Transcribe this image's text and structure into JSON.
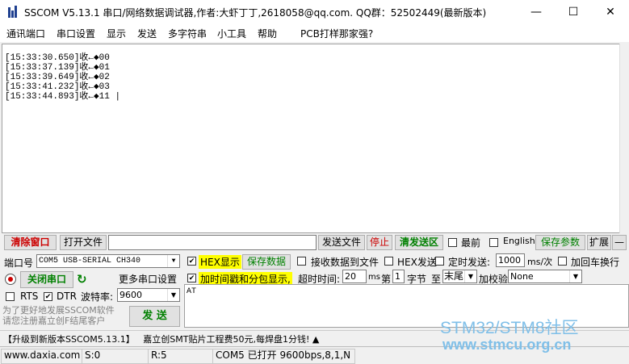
{
  "window": {
    "title": "SSCOM V5.13.1 串口/网络数据调试器,作者:大虾丁丁,2618058@qq.com. QQ群：52502449(最新版本)",
    "minimize": "—",
    "maximize": "☐",
    "close": "✕"
  },
  "menu": [
    "通讯端口",
    "串口设置",
    "显示",
    "发送",
    "多字符串",
    "小工具",
    "帮助",
    "PCB打样那家强?"
  ],
  "receive": {
    "lines": [
      "[15:33:30.650]收←◆00",
      "[15:33:37.139]收←◆01",
      "[15:33:39.649]收←◆02",
      "[15:33:41.232]收←◆03",
      "[15:33:44.893]收←◆11 |"
    ]
  },
  "toolbar1": {
    "clear_window": "清除窗口",
    "open_file": "打开文件",
    "file_path": "",
    "send_file": "发送文件",
    "stop": "停止",
    "clear_send": "清发送区",
    "front": "最前",
    "english": "English",
    "save_params": "保存参数",
    "expand": "扩展",
    "collapse": "—"
  },
  "port": {
    "label": "端口号",
    "value": "COM5 USB-SERIAL CH340",
    "close_port": "关闭串口",
    "more_settings": "更多串口设置",
    "rts": "RTS",
    "dtr": "DTR",
    "baud_label": "波特率:",
    "baud_value": "9600"
  },
  "options": {
    "hex_display": "HEX显示",
    "save_data": "保存数据",
    "recv_to_file": "接收数据到文件",
    "hex_send": "HEX发送",
    "timed_send": "定时发送:",
    "interval": "1000",
    "interval_unit": "ms/次",
    "add_crlf": "加回车换行",
    "timestamp": "加时间戳和分包显示,",
    "timeout_label": "超时时间:",
    "timeout_value": "20",
    "timeout_unit": "ms",
    "byte_index_label": "第",
    "byte_index": "1",
    "byte_label": "字节",
    "to_label": "至",
    "to_value": "末尾",
    "checksum_label": "加校验",
    "checksum_value": "None"
  },
  "send": {
    "text": "AT",
    "button": "发 送",
    "promo": "为了更好地发展SSCOM软件\n请您注册嘉立创F结尾客户"
  },
  "ticker": "【升级到新版本SSCOM5.13.1】   嘉立创SMT贴片工程费50元,每焊盘1分钱! ▲",
  "status": {
    "site": "www.daxia.com",
    "sent": "S:0",
    "received": "R:5",
    "port_state": "COM5 已打开  9600bps,8,1,N"
  },
  "watermark": {
    "line1": "STM32/STM8社区",
    "line2": "www.stmcu.org.cn"
  },
  "colors": {
    "hex_highlight": "#ffff00",
    "red_text": "#cc0000",
    "green_text": "#008000",
    "watermark": "#7fbfe8"
  }
}
